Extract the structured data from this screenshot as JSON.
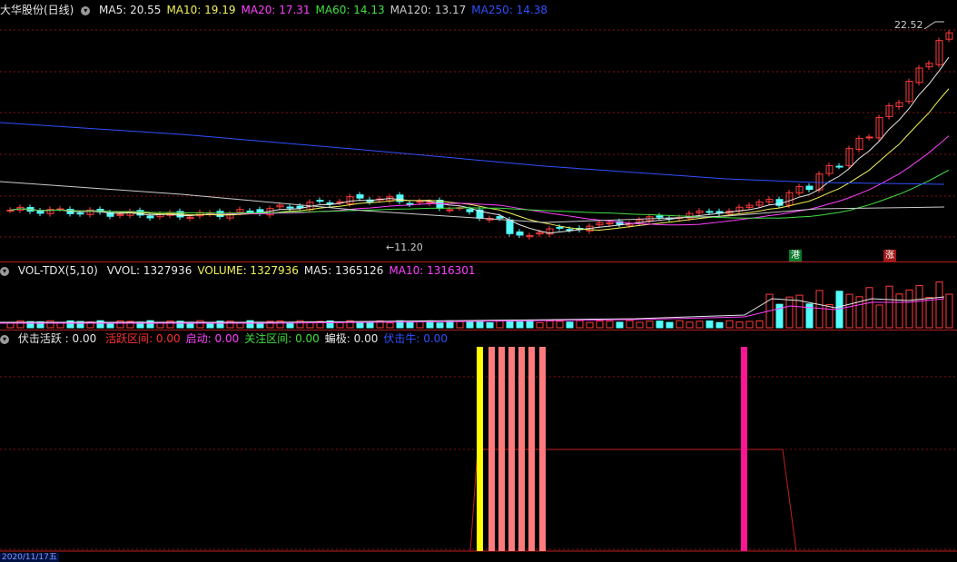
{
  "stock": {
    "name": "大华股份(日线)"
  },
  "price_panel": {
    "ma": [
      {
        "label": "MA5: 20.55",
        "color": "#e8e8e8"
      },
      {
        "label": "MA10: 19.19",
        "color": "#f2f25a"
      },
      {
        "label": "MA20: 17.31",
        "color": "#ff40ff"
      },
      {
        "label": "MA60: 14.13",
        "color": "#40e040"
      },
      {
        "label": "MA120: 13.17",
        "color": "#cccccc"
      },
      {
        "label": "MA250: 14.38",
        "color": "#3050ff"
      }
    ],
    "high_label": "22.52",
    "low_label": "11.20",
    "tag_gang": "港",
    "tag_zhang": "涨"
  },
  "volume_panel": {
    "title": "VOL-TDX(5,10)",
    "items": [
      {
        "label": "VVOL: 1327936",
        "color": "#e8e8e8"
      },
      {
        "label": "VOLUME: 1327936",
        "color": "#f2f25a"
      },
      {
        "label": "MA5: 1365126",
        "color": "#e8e8e8"
      },
      {
        "label": "MA10: 1316301",
        "color": "#ff40ff"
      }
    ]
  },
  "indicator_panel": {
    "title": "伏击活跃 : 0.00",
    "items": [
      {
        "label": "活跃区间: 0.00",
        "color": "#ff3030"
      },
      {
        "label": "启动: 0.00",
        "color": "#ff40ff"
      },
      {
        "label": "关注区间: 0.00",
        "color": "#40e040"
      },
      {
        "label": "蝙极: 0.00",
        "color": "#e8e8e8"
      },
      {
        "label": "伏击牛: 0.00",
        "color": "#3050ff"
      }
    ]
  },
  "bottom_date": "2020/11/17五",
  "colors": {
    "up": "#ff3b3b",
    "down": "#54fcfc",
    "grid": "#8a1010",
    "yellow_bar": "#ffff00",
    "pink_bar": "#ff7b7b",
    "magenta_bar": "#ff1493"
  }
}
